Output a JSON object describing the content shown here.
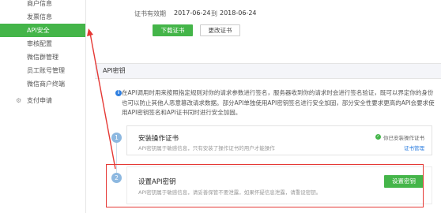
{
  "sidebar": {
    "items": [
      {
        "label": "商户信息"
      },
      {
        "label": "发票信息"
      },
      {
        "label": "API安全"
      },
      {
        "label": "审核配置"
      },
      {
        "label": "微信群管理"
      },
      {
        "label": "员工账号管理"
      },
      {
        "label": "微信商户终端"
      },
      {
        "label": "支付申请"
      }
    ]
  },
  "cert": {
    "validity_label": "证书有效期",
    "start_date": "2017-06-24",
    "to": "到",
    "end_date": "2018-06-24",
    "download_label": "下载证书",
    "update_label": "更改证书"
  },
  "section": {
    "title": "API密钥"
  },
  "notice": {
    "text": "在API调用时用来按照指定规则对你的请求参数进行签名，服务器收到你的请求时会进行签名验证，既可以界定你的身份也可以防止其他人恶意篡改请求数据。部分API单独使用API密钥签名进行安全加固，部分安全性要求更高的API会要求使用API密钥签名和API证书同时进行安全加固。"
  },
  "steps": [
    {
      "number": "1",
      "title": "安装操作证书",
      "desc": "API密钥属于敏感信息，只有安装了操作证书的用户才能操作",
      "status": "你已安装操作证书",
      "link": "证书管理"
    },
    {
      "number": "2",
      "title": "设置API密钥",
      "desc": "API密钥属于敏感信息，请妥善保管不要泄露，如果怀疑信息泄露，请重设密钥。",
      "button": "设置密钥"
    }
  ],
  "colors": {
    "accent": "#44b549",
    "highlight": "#e53935"
  }
}
